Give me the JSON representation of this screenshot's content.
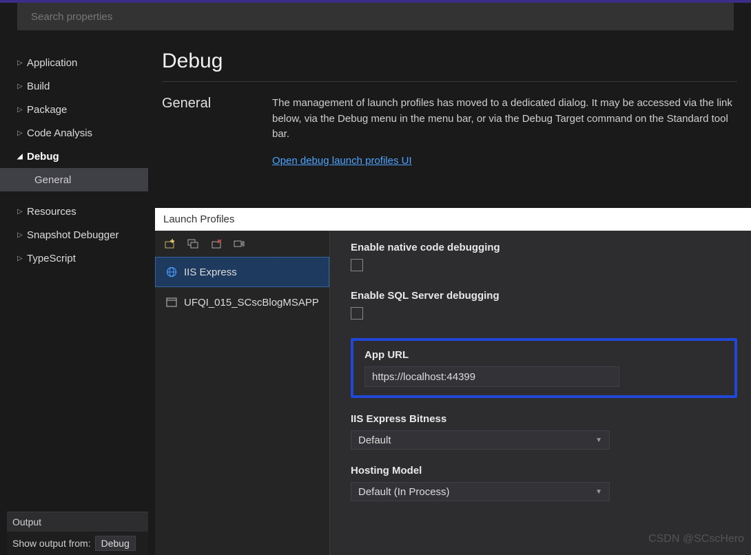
{
  "search": {
    "placeholder": "Search properties"
  },
  "sidebar": {
    "items": [
      {
        "label": "Application",
        "expanded": false
      },
      {
        "label": "Build",
        "expanded": false
      },
      {
        "label": "Package",
        "expanded": false
      },
      {
        "label": "Code Analysis",
        "expanded": false
      },
      {
        "label": "Debug",
        "expanded": true,
        "children": [
          {
            "label": "General",
            "selected": true
          }
        ]
      },
      {
        "label": "Resources",
        "expanded": false
      },
      {
        "label": "Snapshot Debugger",
        "expanded": false
      },
      {
        "label": "TypeScript",
        "expanded": false
      }
    ]
  },
  "page": {
    "title": "Debug",
    "section_label": "General",
    "description": "The management of launch profiles has moved to a dedicated dialog. It may be accessed via the link below, via the Debug menu in the menu bar, or via the Debug Target command on the Standard tool bar.",
    "link": "Open debug launch profiles UI"
  },
  "dialog": {
    "title": "Launch Profiles",
    "toolbar_icons": [
      "new-profile-icon",
      "duplicate-profile-icon",
      "delete-profile-icon",
      "rename-profile-icon"
    ],
    "profiles": [
      {
        "label": "IIS Express",
        "icon": "globe-icon",
        "selected": true
      },
      {
        "label": "UFQI_015_SCscBlogMSAPP",
        "icon": "window-icon",
        "selected": false
      }
    ],
    "settings": {
      "enable_native": {
        "label": "Enable native code debugging",
        "checked": false
      },
      "enable_sql": {
        "label": "Enable SQL Server debugging",
        "checked": false
      },
      "app_url": {
        "label": "App URL",
        "value": "https://localhost:44399"
      },
      "bitness": {
        "label": "IIS Express Bitness",
        "value": "Default"
      },
      "hosting": {
        "label": "Hosting Model",
        "value": "Default (In Process)"
      }
    }
  },
  "output": {
    "title": "Output",
    "show_label": "Show output from:",
    "show_value": "Debug"
  },
  "watermark": "CSDN @SCscHero"
}
